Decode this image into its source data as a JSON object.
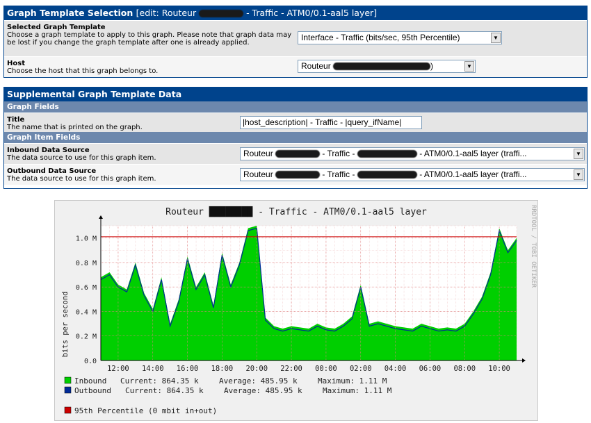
{
  "template_panel": {
    "title": "Graph Template Selection",
    "edit_prefix": "[edit: Routeur",
    "edit_suffix": "- Traffic - ATM0/0.1-aal5 layer]",
    "rows": [
      {
        "label": "Selected Graph Template",
        "desc": "Choose a graph template to apply to this graph. Please note that graph data may be lost if you change the graph template after one is already applied.",
        "value": "Interface - Traffic (bits/sec, 95th Percentile)"
      },
      {
        "label": "Host",
        "desc": "Choose the host that this graph belongs to.",
        "value_prefix": "Routeur",
        "value_suffix": ")"
      }
    ]
  },
  "supplemental_panel": {
    "title": "Supplemental Graph Template Data",
    "graph_fields_header": "Graph Fields",
    "title_row": {
      "label": "Title",
      "desc": "The name that is printed on the graph.",
      "value": "|host_description| - Traffic - |query_ifName|"
    },
    "graph_item_fields_header": "Graph Item Fields",
    "inbound": {
      "label": "Inbound Data Source",
      "desc": "The data source to use for this graph item.",
      "v1": "Routeur",
      "v2": "- Traffic -",
      "v3": "- ATM0/0.1-aal5 layer (traffi..."
    },
    "outbound": {
      "label": "Outbound Data Source",
      "desc": "The data source to use for this graph item.",
      "v1": "Routeur",
      "v2": "- Traffic -",
      "v3": "- ATM0/0.1-aal5 layer (traffi..."
    }
  },
  "graph": {
    "title_prefix": "Routeur",
    "title_suffix": "- Traffic - ATM0/0.1-aal5 layer",
    "watermark": "RRDTOOL / TOBI OETIKER",
    "legend": [
      {
        "name": "Inbound",
        "current": "Current:   864.35 k",
        "average": "Average:   485.95 k",
        "maximum": "Maximum:     1.11 M",
        "color": "#00CF00"
      },
      {
        "name": "Outbound",
        "current": "Current:   864.35 k",
        "average": "Average:   485.95 k",
        "maximum": "Maximum:     1.11 M",
        "color": "#002A97"
      }
    ],
    "percentile_text": "95th Percentile   (0 mbit in+out)",
    "percentile_color": "#CC0000"
  },
  "chart_data": {
    "type": "area",
    "title": "Routeur - Traffic - ATM0/0.1-aal5 layer",
    "ylabel": "bits per second",
    "xlabel": "",
    "ylim": [
      0,
      1.1
    ],
    "yticks": [
      "0.0",
      "0.2 M",
      "0.4 M",
      "0.6 M",
      "0.8 M",
      "1.0 M"
    ],
    "x_ticks": [
      "12:00",
      "14:00",
      "16:00",
      "18:00",
      "20:00",
      "22:00",
      "00:00",
      "02:00",
      "04:00",
      "06:00",
      "08:00",
      "10:00"
    ],
    "x_hours": [
      11.0,
      11.5,
      12.0,
      12.5,
      13.0,
      13.5,
      14.0,
      14.5,
      15.0,
      15.5,
      16.0,
      16.5,
      17.0,
      17.5,
      18.0,
      18.5,
      19.0,
      19.5,
      20.0,
      20.5,
      21.0,
      21.5,
      22.0,
      22.5,
      23.0,
      23.5,
      24.0,
      24.5,
      25.0,
      25.5,
      26.0,
      26.5,
      27.0,
      27.5,
      28.0,
      28.5,
      29.0,
      29.5,
      30.0,
      30.5,
      31.0,
      31.5,
      32.0,
      32.5,
      33.0,
      33.5,
      34.0,
      34.5,
      35.0
    ],
    "series": [
      {
        "name": "Inbound",
        "values": [
          0.68,
          0.72,
          0.62,
          0.58,
          0.8,
          0.55,
          0.42,
          0.68,
          0.3,
          0.5,
          0.85,
          0.6,
          0.72,
          0.45,
          0.88,
          0.62,
          0.8,
          1.08,
          1.1,
          0.35,
          0.28,
          0.26,
          0.28,
          0.27,
          0.26,
          0.3,
          0.27,
          0.26,
          0.3,
          0.36,
          0.62,
          0.3,
          0.32,
          0.3,
          0.28,
          0.27,
          0.26,
          0.3,
          0.28,
          0.26,
          0.27,
          0.26,
          0.3,
          0.4,
          0.52,
          0.72,
          1.08,
          0.9,
          1.0
        ]
      },
      {
        "name": "Outbound",
        "values": [
          0.66,
          0.7,
          0.6,
          0.56,
          0.78,
          0.53,
          0.4,
          0.66,
          0.28,
          0.48,
          0.83,
          0.58,
          0.7,
          0.43,
          0.86,
          0.6,
          0.78,
          1.06,
          1.08,
          0.33,
          0.26,
          0.24,
          0.26,
          0.25,
          0.24,
          0.28,
          0.25,
          0.24,
          0.28,
          0.34,
          0.6,
          0.28,
          0.3,
          0.28,
          0.26,
          0.25,
          0.24,
          0.28,
          0.26,
          0.24,
          0.25,
          0.24,
          0.28,
          0.38,
          0.5,
          0.7,
          1.06,
          0.88,
          0.98
        ]
      }
    ],
    "percentile_value": 1.01
  }
}
